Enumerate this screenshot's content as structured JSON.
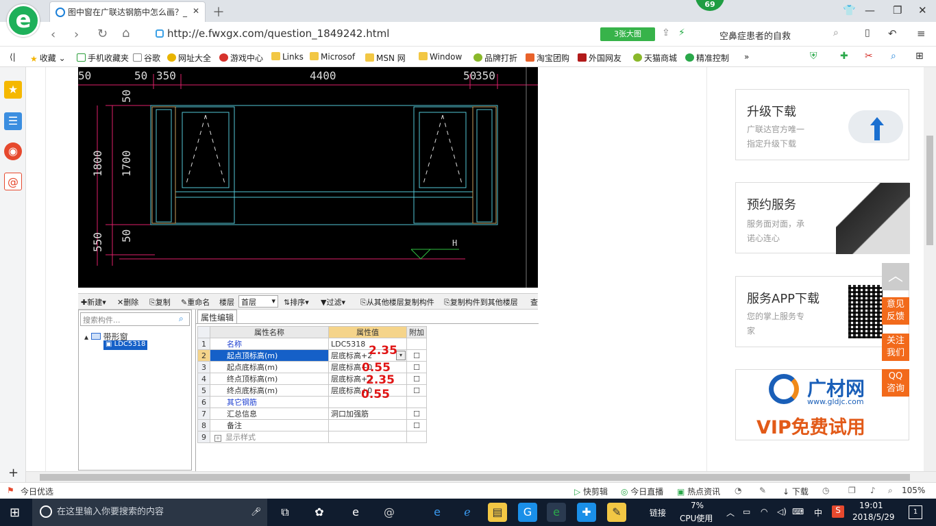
{
  "browser": {
    "tab_title": "图中窗在广联达钢筋中怎么画？_",
    "badge_count": "69",
    "url": "http://e.fwxgx.com/question_1849242.html",
    "big_image_button": "3张大图",
    "search_text": "空鼻症患者的自救",
    "bookmarks": [
      "收藏",
      "手机收藏夹",
      "谷歌",
      "网址大全",
      "游戏中心",
      "Links",
      "Microsof",
      "MSN 网",
      "Window",
      "品牌打折",
      "淘宝团购",
      "外国网友",
      "天猫商城",
      "精准控制"
    ]
  },
  "cad": {
    "dims_top": [
      "50",
      "50",
      "350",
      "4400",
      "50",
      "350"
    ],
    "dims_left": [
      "50",
      "1800",
      "1700",
      "550",
      "50"
    ],
    "h_label": "H"
  },
  "toolbar": {
    "new": "新建",
    "delete": "删除",
    "copy": "复制",
    "rename": "重命名",
    "floor_label": "楼层",
    "floor_value": "首层",
    "sort": "排序",
    "filter": "过滤",
    "copy_from_floor": "从其他楼层复制构件",
    "copy_to_floor": "复制构件到其他楼层",
    "more": "查"
  },
  "tree": {
    "search_placeholder": "搜索构件...",
    "root": "带形窗",
    "child": "LDC5318"
  },
  "grid": {
    "tab": "属性编辑",
    "headers": [
      "属性名称",
      "属性值",
      "附加"
    ],
    "rows": [
      {
        "n": "1",
        "name": "名称",
        "value": "LDC5318"
      },
      {
        "n": "2",
        "name": "起点顶标高(m)",
        "value": "层底标高+2"
      },
      {
        "n": "3",
        "name": "起点底标高(m)",
        "value": "层底标高+0"
      },
      {
        "n": "4",
        "name": "终点顶标高(m)",
        "value": "层底标高+2"
      },
      {
        "n": "5",
        "name": "终点底标高(m)",
        "value": "层底标高+0"
      },
      {
        "n": "6",
        "name": "其它钢筋",
        "value": ""
      },
      {
        "n": "7",
        "name": "汇总信息",
        "value": "洞口加强筋"
      },
      {
        "n": "8",
        "name": "备注",
        "value": ""
      },
      {
        "n": "9",
        "name": "显示样式",
        "value": ""
      }
    ],
    "annotations": [
      "2.35",
      "0.55",
      "2.35",
      "0.55"
    ]
  },
  "right": {
    "upgrade_title": "升级下载",
    "upgrade_sub1": "广联达官方唯一",
    "upgrade_sub2": "指定升级下载",
    "service_title": "预约服务",
    "service_sub1": "服务面对面，承",
    "service_sub2": "诺心连心",
    "app_title": "服务APP下载",
    "app_sub1": "您的掌上服务专",
    "app_sub2": "家",
    "ad_brand": "广材网",
    "ad_domain": "www.gldjc.com",
    "ad_vip": "VIP免费试用",
    "feedback": "意见反馈",
    "follow": "关注我们",
    "qq": "QQ咨询"
  },
  "status": {
    "left": "今日优选",
    "items": [
      "快剪辑",
      "今日直播",
      "热点资讯",
      "下载"
    ],
    "zoom": "105%"
  },
  "taskbar": {
    "search_placeholder": "在这里输入你要搜索的内容",
    "link": "链接",
    "cpu_pct": "7%",
    "cpu_label": "CPU使用",
    "ime": "中",
    "time": "19:01",
    "date": "2018/5/29",
    "notif": "1"
  },
  "colors": {
    "cad_bg": "#000000",
    "accent_orange": "#f26a1b",
    "green": "#1eb05a",
    "red": "#e01414"
  }
}
